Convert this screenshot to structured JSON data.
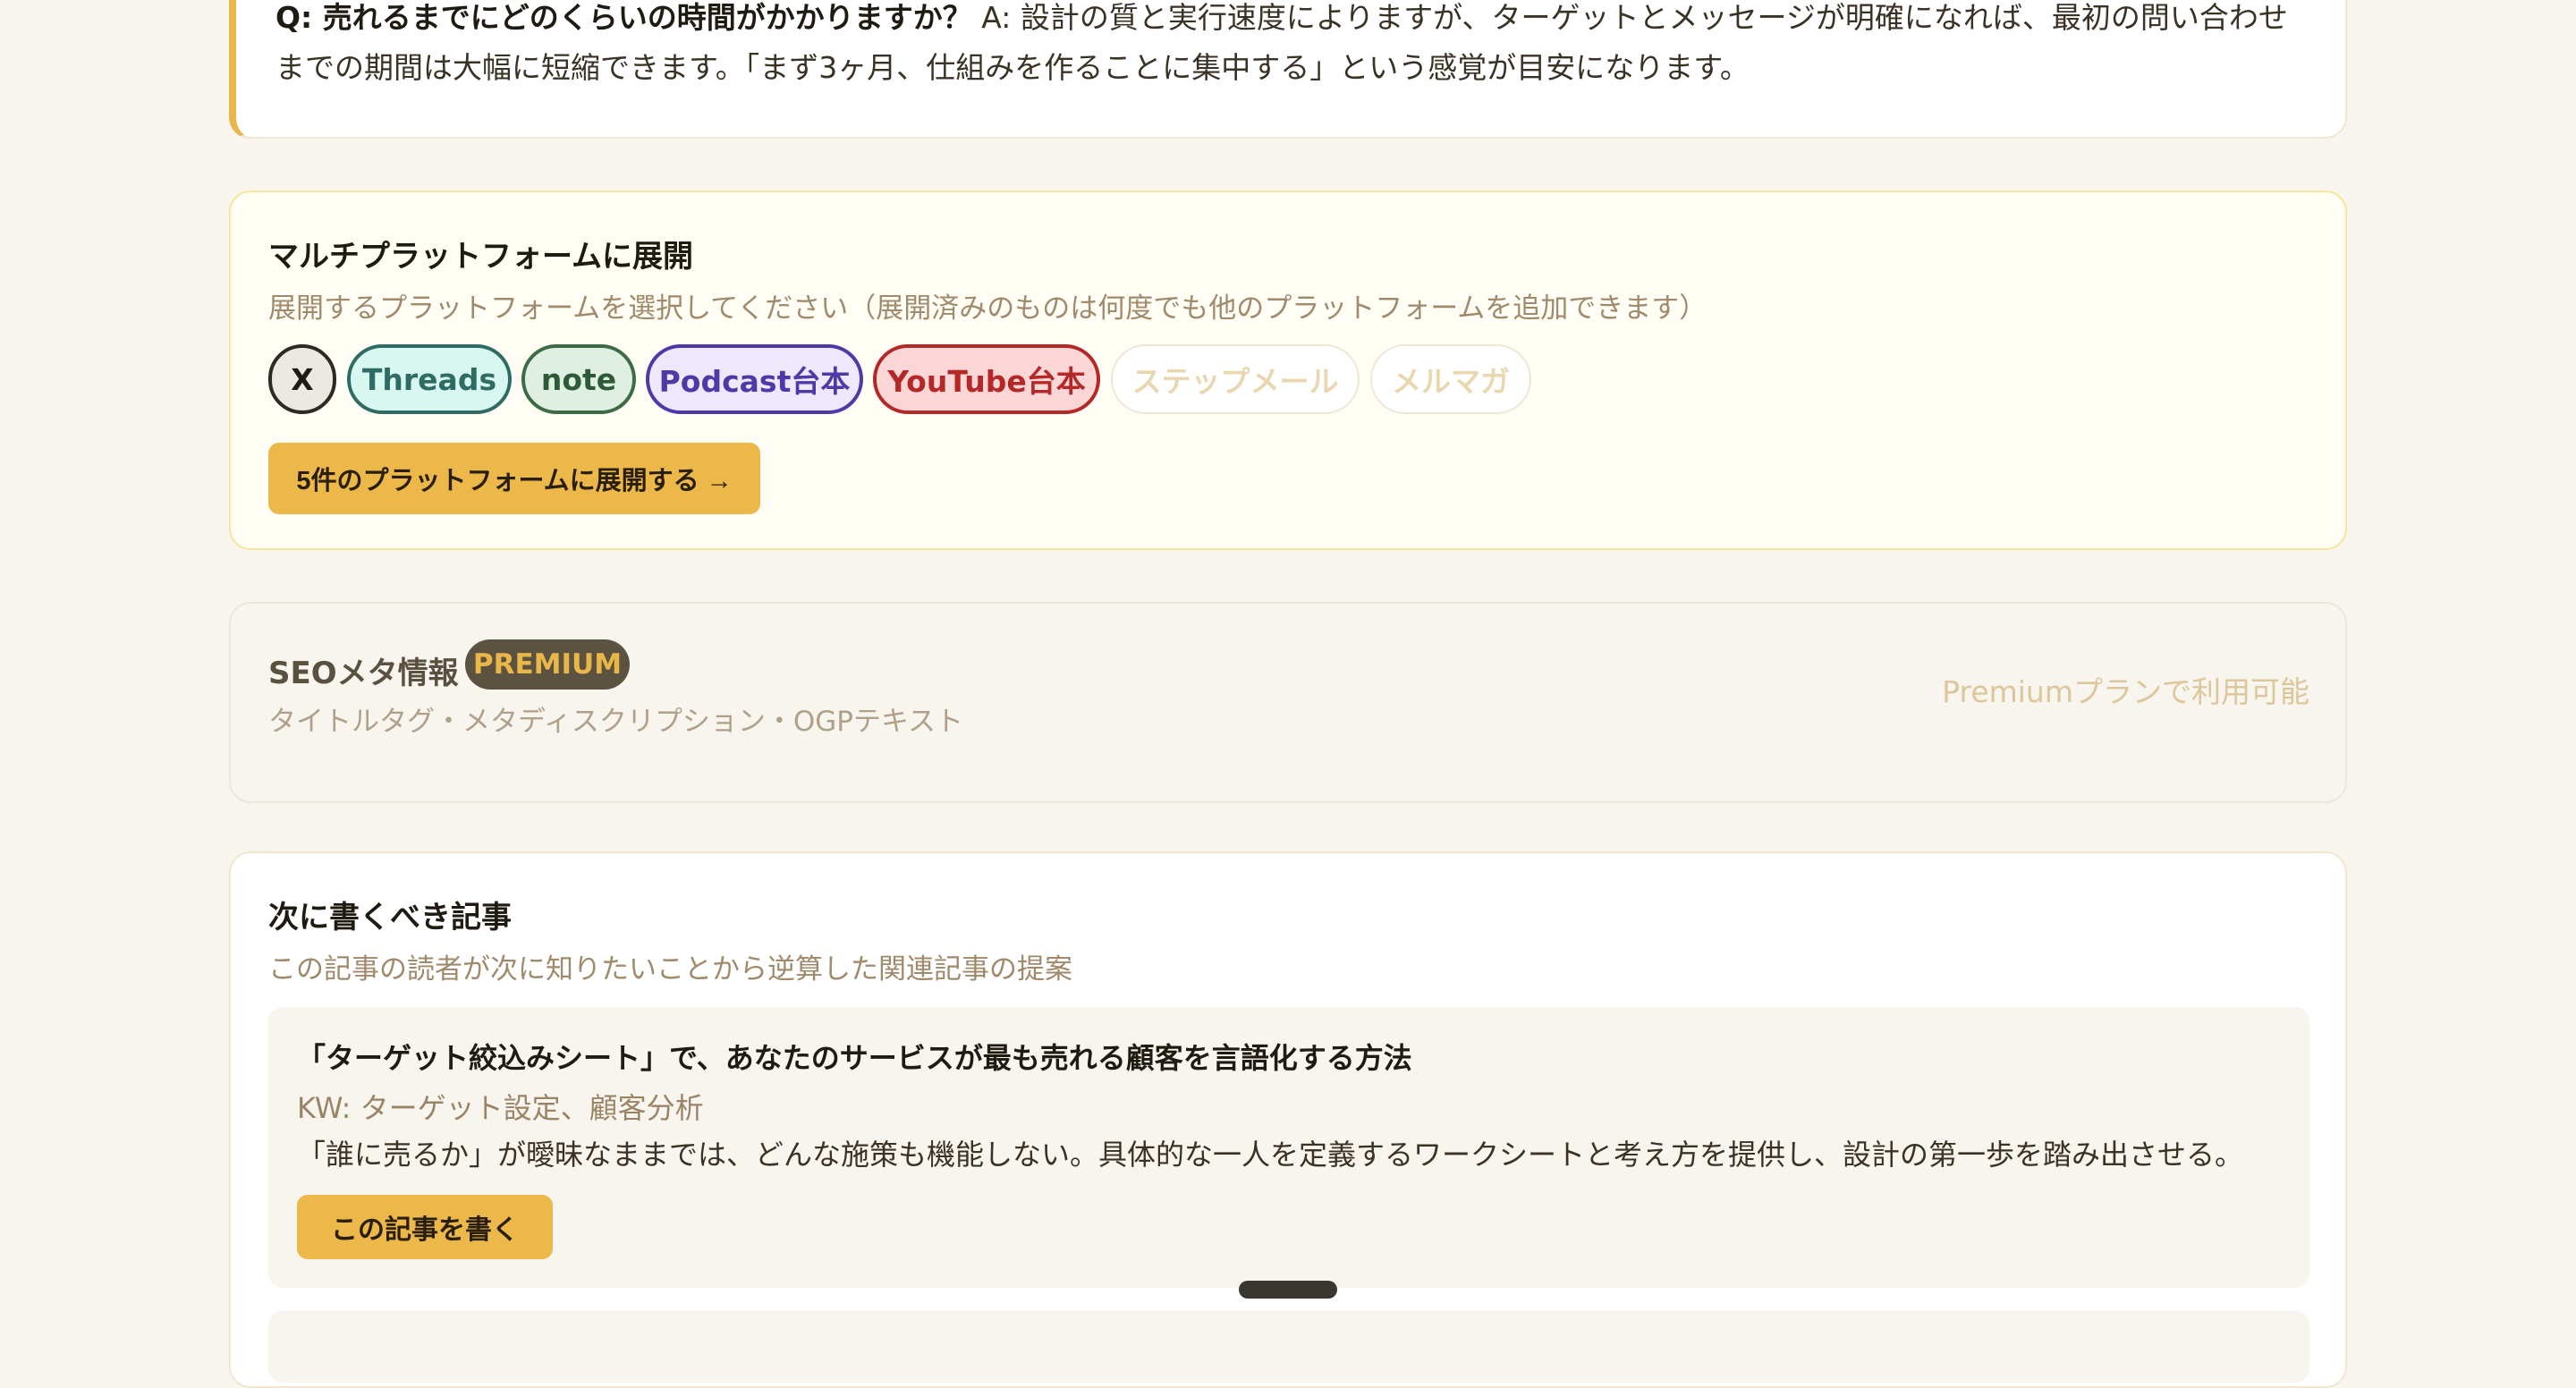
{
  "faq": {
    "question": "Q: 売れるまでにどのくらいの時間がかかりますか？",
    "answer": " A: 設計の質と実行速度によりますが、ターゲットとメッセージが明確になれば、最初の問い合わせまでの期間は大幅に短縮できます。「まず3ヶ月、仕組みを作ることに集中する」という感覚が目安になります。"
  },
  "multi_platform": {
    "title": "マルチプラットフォームに展開",
    "subtitle": "展開するプラットフォームを選択してください（展開済みのものは何度でも他のプラットフォームを追加できます）",
    "platforms": [
      {
        "label": "X",
        "selected": true
      },
      {
        "label": "Threads",
        "selected": true
      },
      {
        "label": "note",
        "selected": true
      },
      {
        "label": "Podcast台本",
        "selected": true
      },
      {
        "label": "YouTube台本",
        "selected": true
      },
      {
        "label": "ステップメール",
        "selected": false
      },
      {
        "label": "メルマガ",
        "selected": false
      }
    ],
    "expand_button": "5件のプラットフォームに展開する →"
  },
  "seo": {
    "title": "SEOメタ情報",
    "badge": "PREMIUM",
    "subtitle": "タイトルタグ・メタディスクリプション・OGPテキスト",
    "availability": "Premiumプランで利用可能"
  },
  "next_articles": {
    "title": "次に書くべき記事",
    "subtitle": "この記事の読者が次に知りたいことから逆算した関連記事の提案",
    "items": [
      {
        "title": "「ターゲット絞込みシート」で、あなたのサービスが最も売れる顧客を言語化する方法",
        "keywords": "KW: ターゲット設定、顧客分析",
        "description": "「誰に売るか」が曖昧なままでは、どんな施策も機能しない。具体的な一人を定義するワークシートと考え方を提供し、設計の第一歩を踏み出させる。",
        "button": "この記事を書く"
      }
    ]
  },
  "colors": {
    "accent": "#ecb84a",
    "background": "#f8f5ef"
  }
}
